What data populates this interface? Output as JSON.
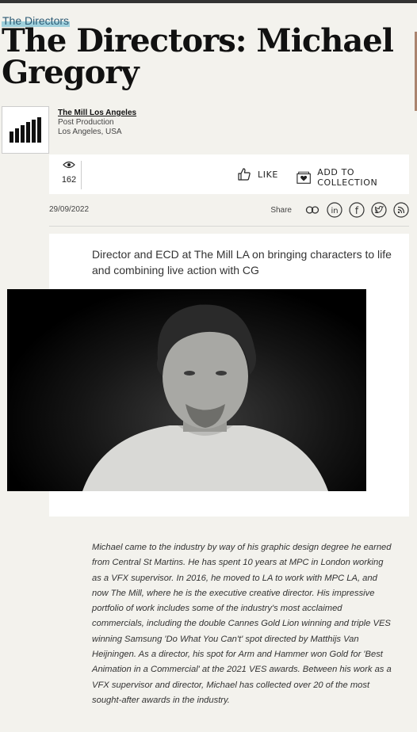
{
  "kicker": "The Directors",
  "headline": "The Directors: Michael Gregory",
  "company": {
    "name": "The Mill Los Angeles",
    "category": "Post Production",
    "location": "Los Angeles, USA"
  },
  "stats": {
    "views": "162",
    "like_label": "LIKE",
    "collection_label": "ADD TO COLLECTION"
  },
  "meta": {
    "date": "29/09/2022",
    "share_label": "Share"
  },
  "article": {
    "standfirst": "Director and ECD at The Mill LA on bringing characters to life and combining live action with CG",
    "body": "Michael came to the industry by way of his graphic design degree he earned from Central St Martins. He has spent 10 years at MPC in London working as a VFX supervisor. In 2016, he moved to LA to work with MPC LA, and now The Mill, where he is the executive creative director. His impressive portfolio of work includes some of the industry's most acclaimed commercials, including the double Cannes Gold Lion winning and triple VES winning Samsung 'Do What You Can't' spot directed by Matthijs Van Heijningen. As a director, his spot for Arm and Hammer won Gold for 'Best Animation in a Commercial' at the 2021 VES awards.  Between his work as a VFX supervisor and director, Michael has collected over 20 of the most sought-after awards in the industry."
  }
}
